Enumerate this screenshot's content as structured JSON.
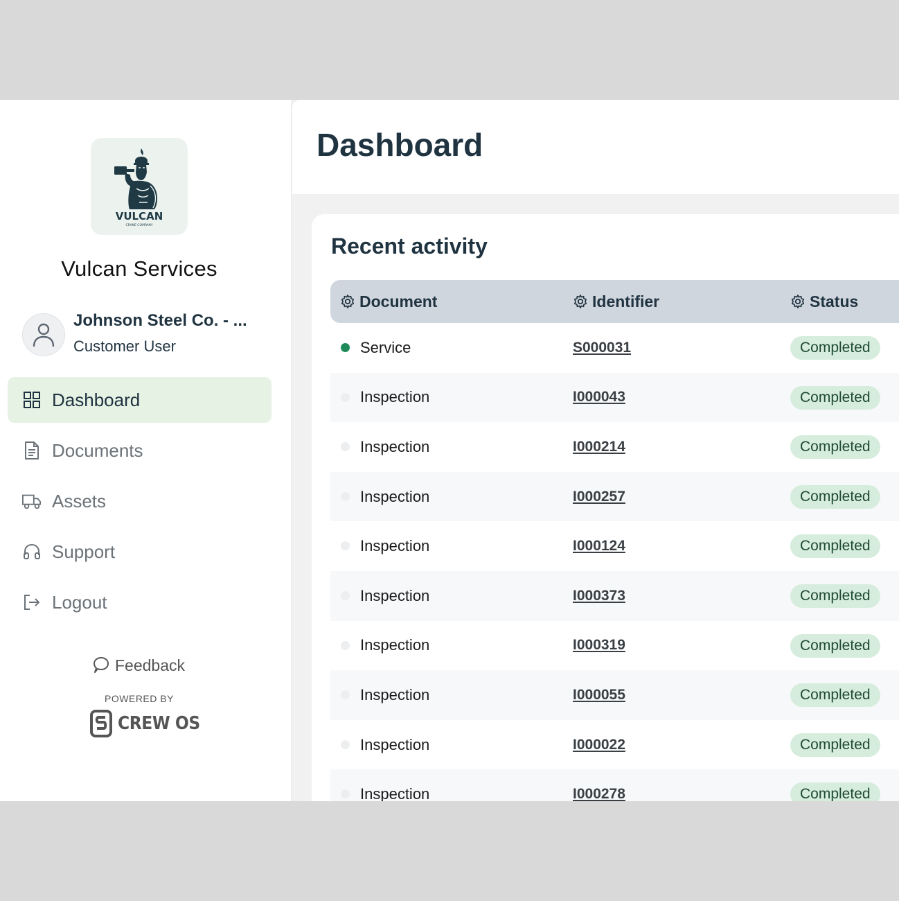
{
  "sidebar": {
    "logo": {
      "text": "VULCAN",
      "subtext": "CRANE COMPANY"
    },
    "company_name": "Vulcan Services",
    "user": {
      "name": "Johnson Steel Co. - ...",
      "role": "Customer User"
    },
    "nav": [
      {
        "label": "Dashboard",
        "icon": "dashboard-grid-icon",
        "active": true
      },
      {
        "label": "Documents",
        "icon": "document-icon",
        "active": false
      },
      {
        "label": "Assets",
        "icon": "truck-icon",
        "active": false
      },
      {
        "label": "Support",
        "icon": "headphones-icon",
        "active": false
      },
      {
        "label": "Logout",
        "icon": "logout-icon",
        "active": false
      }
    ],
    "feedback_label": "Feedback",
    "powered_by": "POWERED BY",
    "brand": "CREW OS"
  },
  "header": {
    "title": "Dashboard"
  },
  "recent_activity": {
    "title": "Recent activity",
    "columns": {
      "document": "Document",
      "identifier": "Identifier",
      "status": "Status"
    },
    "rows": [
      {
        "document": "Service",
        "identifier": "S000031",
        "status": "Completed",
        "dot": "#1e8a5a"
      },
      {
        "document": "Inspection",
        "identifier": "I000043",
        "status": "Completed",
        "dot": "#eceef0"
      },
      {
        "document": "Inspection",
        "identifier": "I000214",
        "status": "Completed",
        "dot": "#eceef0"
      },
      {
        "document": "Inspection",
        "identifier": "I000257",
        "status": "Completed",
        "dot": "#eceef0"
      },
      {
        "document": "Inspection",
        "identifier": "I000124",
        "status": "Completed",
        "dot": "#eceef0"
      },
      {
        "document": "Inspection",
        "identifier": "I000373",
        "status": "Completed",
        "dot": "#eceef0"
      },
      {
        "document": "Inspection",
        "identifier": "I000319",
        "status": "Completed",
        "dot": "#eceef0"
      },
      {
        "document": "Inspection",
        "identifier": "I000055",
        "status": "Completed",
        "dot": "#eceef0"
      },
      {
        "document": "Inspection",
        "identifier": "I000022",
        "status": "Completed",
        "dot": "#eceef0"
      },
      {
        "document": "Inspection",
        "identifier": "I000278",
        "status": "Completed",
        "dot": "#eceef0"
      }
    ]
  },
  "colors": {
    "accent": "#1f3340",
    "active_nav_bg": "#e6f2e4",
    "badge_bg": "#d6ecdc"
  }
}
